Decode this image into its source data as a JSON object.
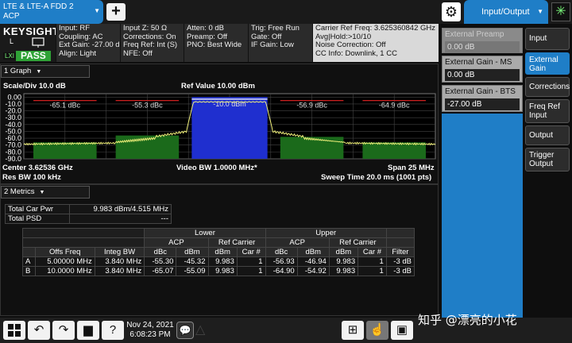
{
  "mode": {
    "line1": "LTE & LTE-A FDD 2",
    "line2": "ACP"
  },
  "tab_io": "Input/Output",
  "brand": "KEYSIGHT",
  "logo_l": "L",
  "lxi": "LXI",
  "pass": "PASS",
  "header": [
    [
      "Input: RF",
      "Coupling: AC",
      "Ext Gain: -27.00 dB",
      "Align: Light"
    ],
    [
      "Input Z: 50 Ω",
      "Corrections: On",
      "Freq Ref: Int (S)",
      "NFE: Off"
    ],
    [
      "Atten: 0 dB",
      "Preamp: Off",
      "PNO: Best Wide"
    ],
    [
      "Trig: Free Run",
      "Gate: Off",
      "IF Gain: Low"
    ],
    [
      "Carrier Ref Freq: 3.625360842 GHz",
      "Avg|Hold:>10/10",
      "Noise Correction: Off",
      "CC Info: Downlink, 1 CC"
    ]
  ],
  "side_settings": [
    {
      "label": "External Preamp",
      "value": "0.00 dB"
    },
    {
      "label": "External Gain - MS",
      "value": "0.00 dB"
    },
    {
      "label": "External Gain - BTS",
      "value": "-27.00 dB"
    }
  ],
  "right_menu": [
    "Input",
    "External Gain",
    "Corrections",
    "Freq Ref Input",
    "Output",
    "Trigger Output"
  ],
  "graph": {
    "window_title": "1 Graph",
    "scale": "Scale/Div 10.0 dB",
    "ref_value": "Ref Value 10.00 dBm",
    "y_ticks": [
      "0.00",
      "-10.0",
      "-20.0",
      "-30.0",
      "-40.0",
      "-50.0",
      "-60.0",
      "-70.0",
      "-80.0",
      "-90.0"
    ],
    "center": "Center 3.62536 GHz",
    "res_bw": "Res BW 100 kHz",
    "video_bw": "Video BW 1.0000 MHz*",
    "span": "Span 25 MHz",
    "sweep": "Sweep Time 20.0 ms (1001 pts)",
    "markers": [
      {
        "label": "-65.1 dBc",
        "level": -65.1
      },
      {
        "label": "-55.3 dBc",
        "level": -55.3
      },
      {
        "label": "-10.0 dBm",
        "level": 9.98
      },
      {
        "label": "-56.9 dBc",
        "level": -56.9
      },
      {
        "label": "-64.9 dBc",
        "level": -64.9
      }
    ]
  },
  "metrics": {
    "window_title": "2 Metrics",
    "total_car_pwr_label": "Total Car Pwr",
    "total_car_pwr": "9.983 dBm/4.515 MHz",
    "total_psd_label": "Total PSD",
    "total_psd": "---",
    "group_lower": "Lower",
    "group_upper": "Upper",
    "acp": "ACP",
    "ref_carrier": "Ref Carrier",
    "col_offs": "Offs Freq",
    "col_integ": "Integ BW",
    "col_dbc": "dBc",
    "col_dbm": "dBm",
    "col_car": "Car #",
    "col_filter": "Filter",
    "rows": [
      {
        "id": "A",
        "offs": "5.00000 MHz",
        "integ": "3.840 MHz",
        "l_dbc": "-55.30",
        "l_dbm": "-45.32",
        "l_ref": "9.983",
        "l_car": "1",
        "u_dbc": "-56.93",
        "u_dbm": "-46.94",
        "u_ref": "9.983",
        "u_car": "1",
        "filter": "-3 dB"
      },
      {
        "id": "B",
        "offs": "10.0000 MHz",
        "integ": "3.840 MHz",
        "l_dbc": "-65.07",
        "l_dbm": "-55.09",
        "l_ref": "9.983",
        "l_car": "1",
        "u_dbc": "-64.90",
        "u_dbm": "-54.92",
        "u_ref": "9.983",
        "u_car": "1",
        "filter": "-3 dB"
      }
    ]
  },
  "taskbar": {
    "date": "Nov 24, 2021",
    "time": "6:08:23 PM"
  },
  "watermark": "知乎 @漂亮的小花",
  "colors": {
    "accent": "#1f7ec7",
    "pass": "#2fa336",
    "trace": "#f0f07a",
    "carrier": "#1f2fcf",
    "mask": "#1b6a1b"
  }
}
